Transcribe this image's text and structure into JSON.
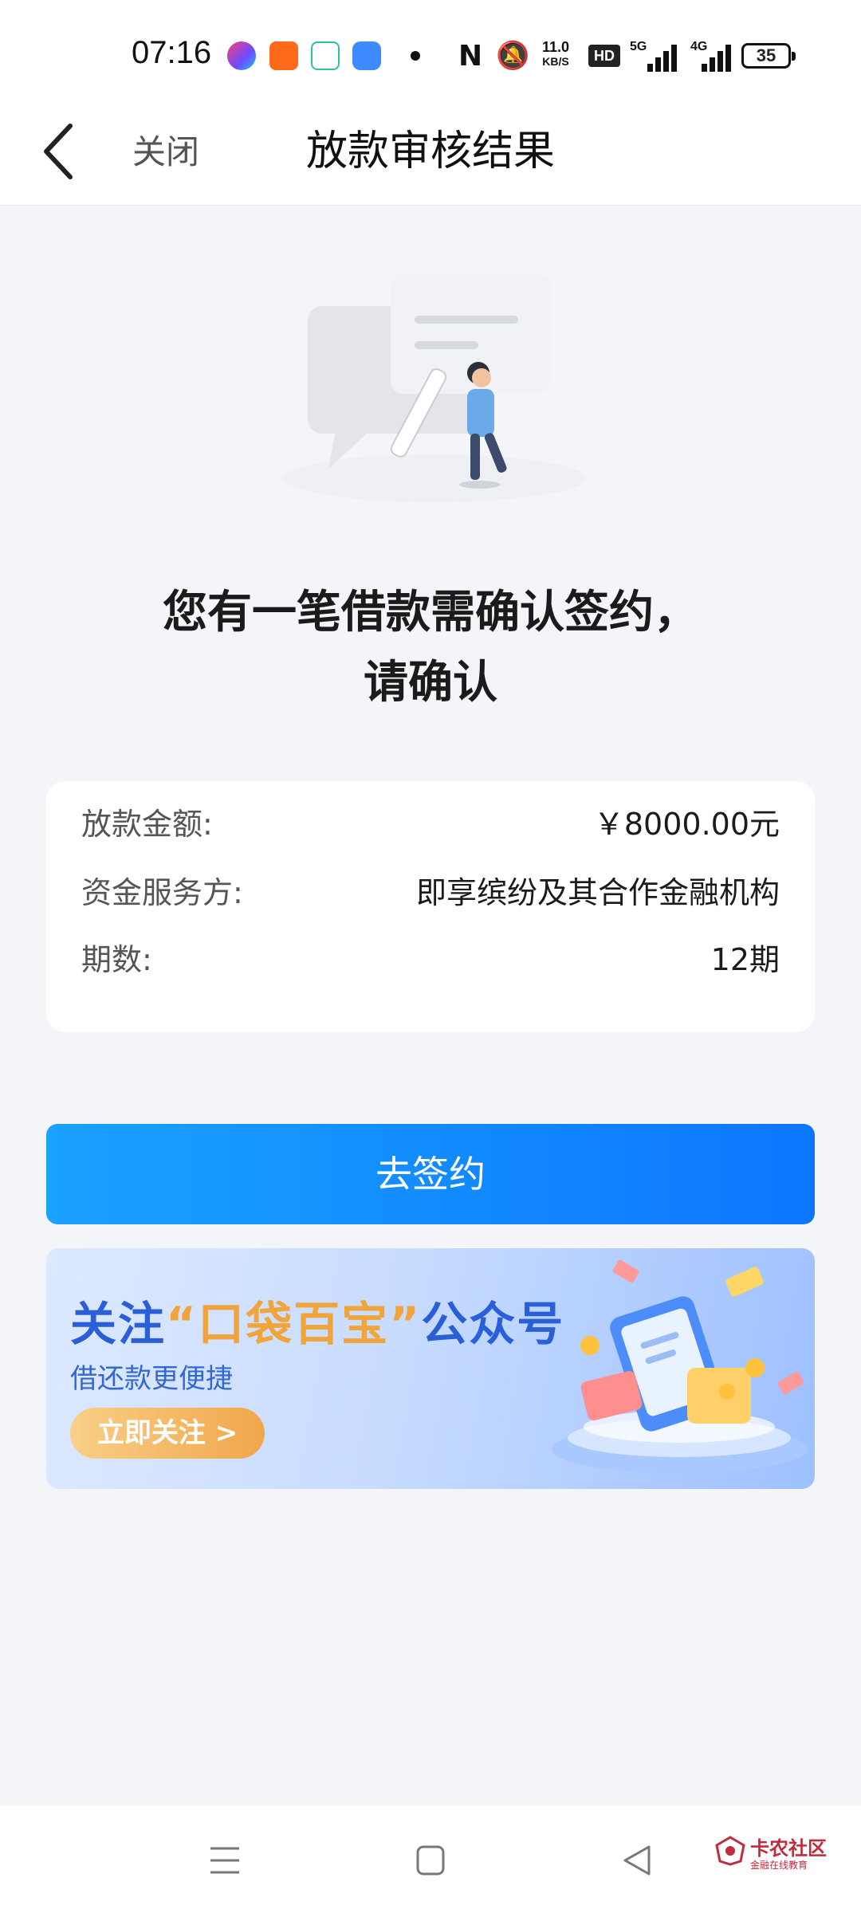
{
  "status_bar": {
    "time": "07:16",
    "net_speed_value": "11.0",
    "net_speed_unit": "KB/S",
    "hd_label": "HD",
    "signal1_label": "5G",
    "signal2_label": "4G",
    "battery": "35",
    "icons": [
      "app-icon",
      "app-icon",
      "app-icon",
      "app-icon",
      "dot-icon",
      "nfc-icon",
      "mute-bell-icon",
      "signal-icon",
      "battery-icon"
    ]
  },
  "header": {
    "close_label": "关闭",
    "title": "放款审核结果"
  },
  "message": {
    "line1": "您有一笔借款需确认签约，",
    "line2": "请确认"
  },
  "info": {
    "rows": [
      {
        "key": "放款金额:",
        "value": "￥8000.00元"
      },
      {
        "key": "资金服务方:",
        "value": "即享缤纷及其合作金融机构"
      },
      {
        "key": "期数:",
        "value": "12期"
      }
    ]
  },
  "sign_button": {
    "label": "去签约"
  },
  "banner": {
    "title_prefix": "关注",
    "title_highlight": "“口袋百宝”",
    "title_suffix": "公众号",
    "subtitle": "借还款更便捷",
    "follow_label": "立即关注 >"
  },
  "watermark": {
    "name": "卡农社区",
    "sub": "金融在线教育"
  },
  "colors": {
    "accent_blue": "#0c76ff",
    "banner_orange": "#f0a43a",
    "background": "#f3f5f9"
  }
}
